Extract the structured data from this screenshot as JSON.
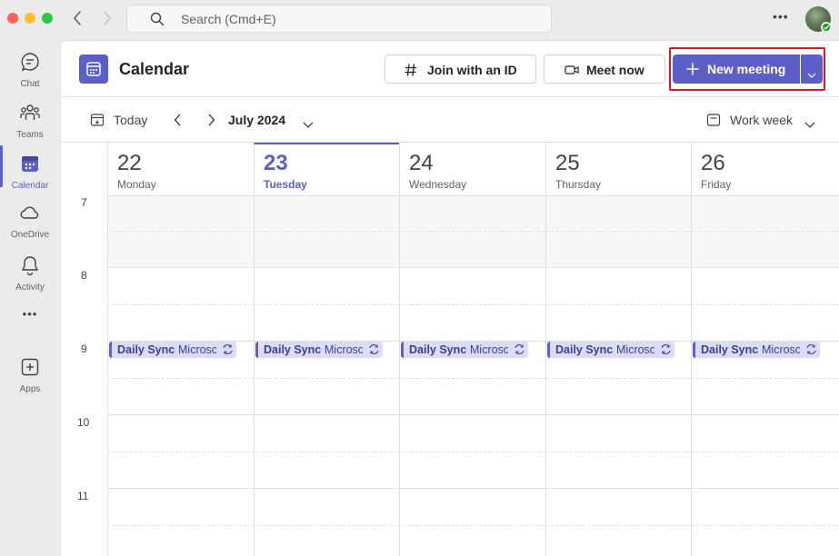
{
  "titlebar": {
    "search_placeholder": "Search (Cmd+E)",
    "more_label": "•••"
  },
  "rail": {
    "items": [
      {
        "label": "Chat",
        "icon": "chat-icon"
      },
      {
        "label": "Teams",
        "icon": "teams-icon"
      },
      {
        "label": "Calendar",
        "icon": "calendar-icon",
        "active": true
      },
      {
        "label": "OneDrive",
        "icon": "cloud-icon"
      },
      {
        "label": "Activity",
        "icon": "bell-icon"
      },
      {
        "label": "•••",
        "icon": "more-icon"
      },
      {
        "label": "Apps",
        "icon": "add-app-icon"
      }
    ]
  },
  "header": {
    "title": "Calendar",
    "join_label": "Join with an ID",
    "meet_label": "Meet now",
    "new_meeting_label": "New meeting"
  },
  "toolbar": {
    "today_label": "Today",
    "month_label": "July 2024",
    "view_label": "Work week"
  },
  "days": [
    {
      "num": "22",
      "name": "Monday",
      "today": false
    },
    {
      "num": "23",
      "name": "Tuesday",
      "today": true
    },
    {
      "num": "24",
      "name": "Wednesday",
      "today": false
    },
    {
      "num": "25",
      "name": "Thursday",
      "today": false
    },
    {
      "num": "26",
      "name": "Friday",
      "today": false
    }
  ],
  "hours": [
    "7",
    "8",
    "9",
    "10",
    "11"
  ],
  "event": {
    "title": "Daily Sync",
    "location": "Microsoft"
  },
  "colors": {
    "accent": "#5b5fc7",
    "highlight": "#d8171e",
    "event_bg": "#dcdcf7"
  }
}
